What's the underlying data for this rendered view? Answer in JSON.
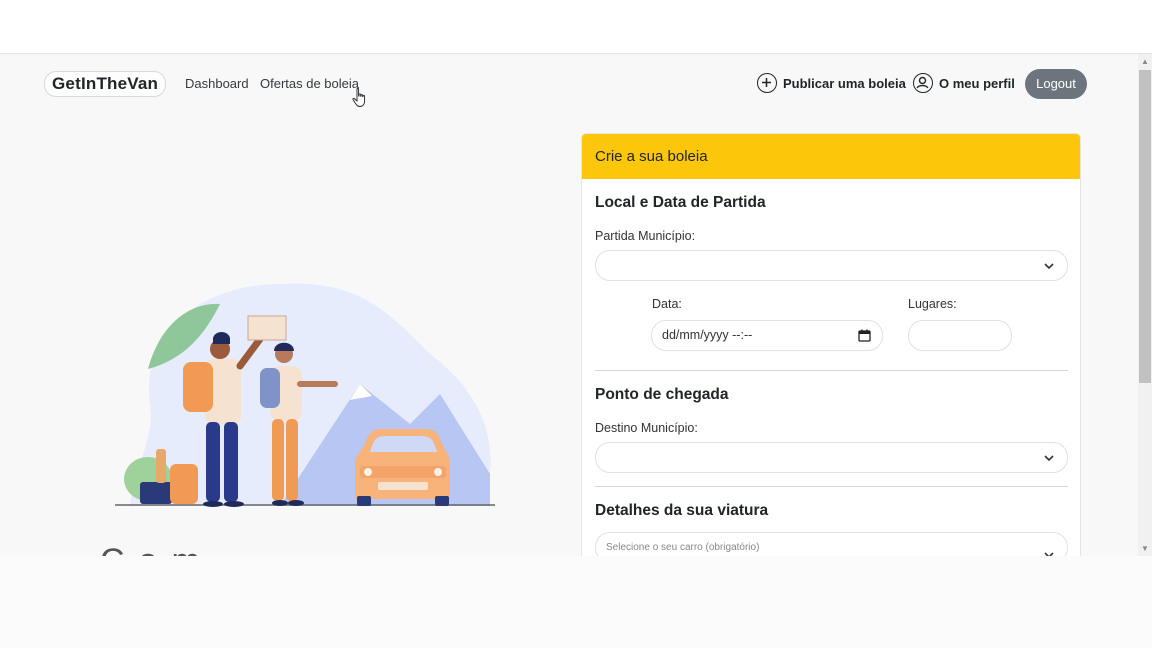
{
  "nav": {
    "brand": "GetInTheVan",
    "links": [
      "Dashboard",
      "Ofertas de boleia"
    ],
    "publicar": "Publicar uma boleia",
    "perfil": "O meu perfil",
    "logout": "Logout"
  },
  "hero": {
    "heading_partial": "Com..."
  },
  "form": {
    "header": "Crie a sua boleia",
    "partida_title": "Local e Data de Partida",
    "partida_label": "Partida Município:",
    "partida_value": "",
    "data_label": "Data:",
    "data_value": "dd/mm/yyyy --:--",
    "lugares_label": "Lugares:",
    "lugares_value": "",
    "chegada_title": "Ponto de chegada",
    "destino_label": "Destino Município:",
    "destino_value": "",
    "viatura_title": "Detalhes da sua viatura",
    "carro_placeholder": "Selecione o seu carro (obrigatório)"
  },
  "colors": {
    "accent": "#fcc70a",
    "logout_bg": "#6c757d",
    "page_bg": "#f8f8f8"
  },
  "icons": [
    "plus-circle-icon",
    "user-circle-icon",
    "chevron-down-icon",
    "calendar-icon",
    "hand-cursor-icon"
  ]
}
